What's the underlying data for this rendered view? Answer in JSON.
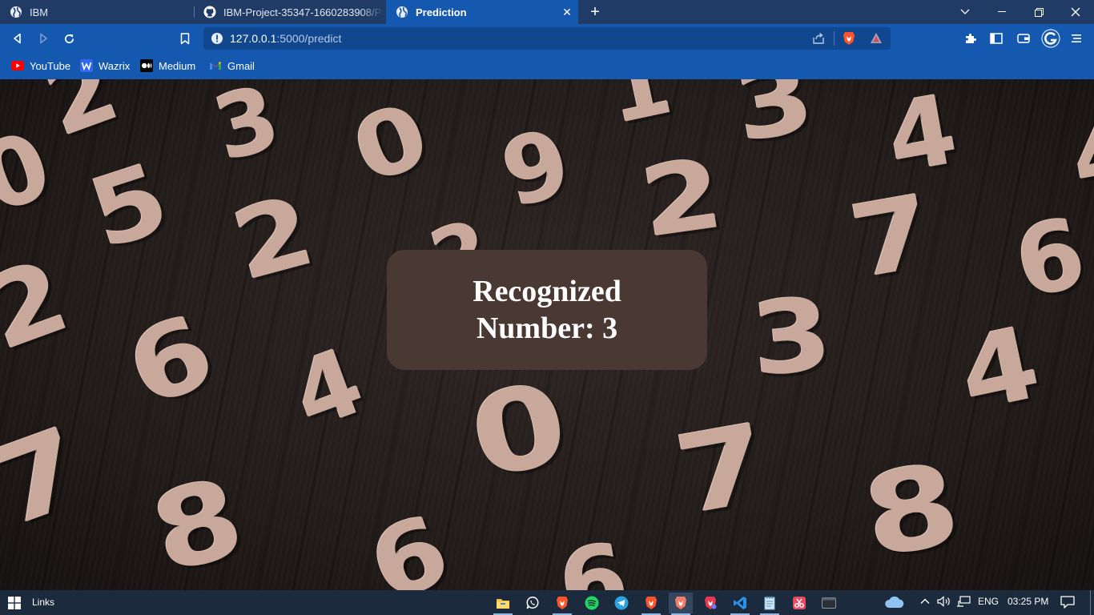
{
  "browser": {
    "tabs": [
      {
        "label": "IBM",
        "icon": "globe-icon"
      },
      {
        "label": "IBM-Project-35347-1660283908/Proje",
        "icon": "github-icon"
      },
      {
        "label": "Prediction",
        "icon": "globe-icon",
        "active": true
      }
    ],
    "url": {
      "host": "127.0.0.1",
      "path": ":5000/predict"
    },
    "bookmarks": [
      {
        "label": "YouTube",
        "icon": "youtube-icon"
      },
      {
        "label": "Wazrix",
        "icon": "wazirx-icon"
      },
      {
        "label": "Medium",
        "icon": "medium-icon"
      },
      {
        "label": "Gmail",
        "icon": "gmail-icon"
      }
    ]
  },
  "page": {
    "result_text": "Recognized Number: 3",
    "background_digits": [
      "2",
      "3",
      "0",
      "9",
      "1",
      "3",
      "4",
      "0",
      "5",
      "2",
      "2",
      "7",
      "6",
      "2",
      "2",
      "3",
      "6",
      "4",
      "4",
      "6",
      "4",
      "0",
      "7",
      "7",
      "8",
      "6",
      "8"
    ]
  },
  "taskbar": {
    "links_label": "Links",
    "language": "ENG",
    "time": "03:25 PM",
    "apps": [
      "file-explorer-icon",
      "whatsapp-icon",
      "brave-icon",
      "spotify-icon",
      "telegram-icon",
      "brave-icon",
      "brave-beta-icon",
      "brave-nightly-icon",
      "vscode-icon",
      "notepad-icon",
      "snipping-icon",
      "terminal-icon"
    ]
  },
  "colors": {
    "tabbar": "#1f3b66",
    "toolbar": "#1558b0",
    "card": "#4a3933",
    "digit": "#c8a89b"
  }
}
